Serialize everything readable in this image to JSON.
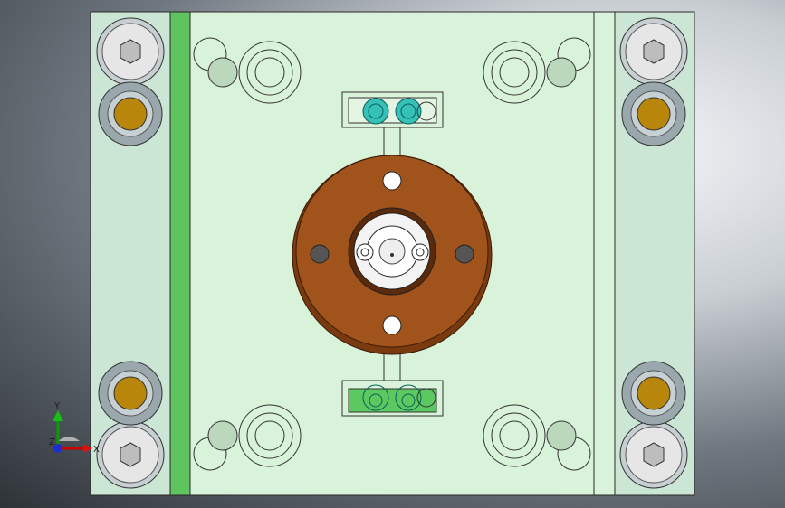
{
  "viewport": {
    "background": "gradient-gray",
    "plate_color": "#d6f0d6",
    "rail_color": "#cce6d4",
    "accent_green": "#5bc860",
    "flange_color": "#a0501a",
    "bushing_color": "#b8860b"
  },
  "triad": {
    "y_label": "Y",
    "x_label": "X",
    "z_label": "Z"
  }
}
